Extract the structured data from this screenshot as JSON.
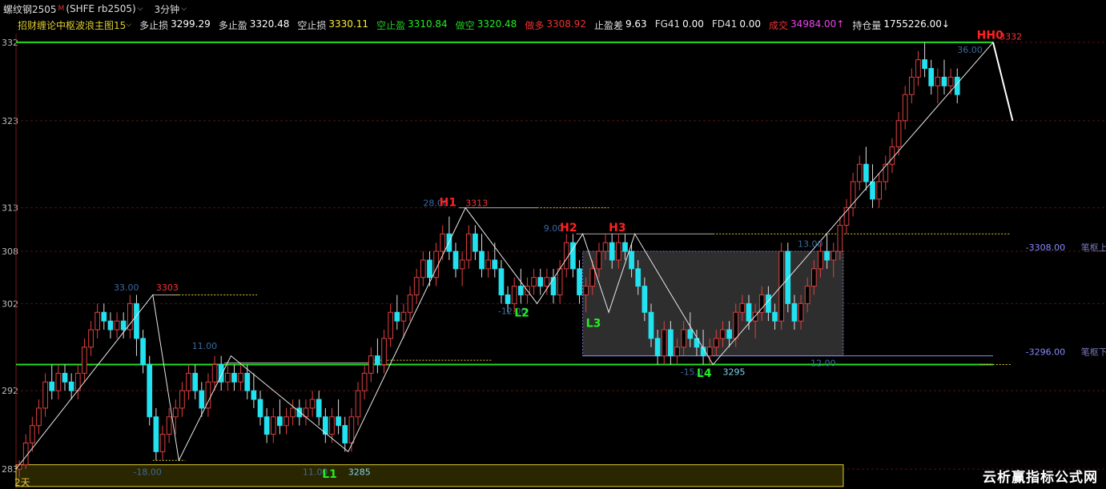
{
  "header": {
    "symbol": "螺纹钢2505",
    "mark": "M",
    "code": "(SHFE rb2505)",
    "period": "3分钟"
  },
  "indicator": {
    "name": "招财缠论中枢波浪主图15",
    "items": [
      {
        "label": "多止损",
        "value": "3299.29",
        "label_color": "#dddddd",
        "value_color": "#ffffff"
      },
      {
        "label": "多止盈",
        "value": "3320.48",
        "label_color": "#dddddd",
        "value_color": "#ffffff"
      },
      {
        "label": "空止损",
        "value": "3330.11",
        "label_color": "#dddddd",
        "value_color": "#ffee33"
      },
      {
        "label": "空止盈",
        "value": "3310.84",
        "label_color": "#22cc22",
        "value_color": "#22ee22"
      },
      {
        "label": "做空",
        "value": "3320.48",
        "label_color": "#22cc22",
        "value_color": "#22ee22"
      },
      {
        "label": "做多",
        "value": "3308.92",
        "label_color": "#ee3333",
        "value_color": "#ee3333"
      },
      {
        "label": "止盈差",
        "value": "9.63",
        "label_color": "#dddddd",
        "value_color": "#ffffff"
      },
      {
        "label": "FG41",
        "value": "0.00",
        "label_color": "#dddddd",
        "value_color": "#ffffff"
      },
      {
        "label": "FD41",
        "value": "0.00",
        "label_color": "#dddddd",
        "value_color": "#ffffff"
      },
      {
        "label": "成交",
        "value": "34984.00↑",
        "label_color": "#ee3333",
        "value_color": "#ee44ee"
      },
      {
        "label": "持仓量",
        "value": "1755226.00↓",
        "label_color": "#dddddd",
        "value_color": "#ffffff"
      }
    ]
  },
  "footer": {
    "days": "2天",
    "watermark": "云析赢指标公式网"
  },
  "chart_data": {
    "type": "candlestick",
    "y_ticks": [
      {
        "value": 3283,
        "label": "283"
      },
      {
        "value": 3292,
        "label": "292"
      },
      {
        "value": 3302,
        "label": "302"
      },
      {
        "value": 3308,
        "label": "308"
      },
      {
        "value": 3313,
        "label": "313"
      },
      {
        "value": 3323,
        "label": "323"
      },
      {
        "value": 3332,
        "label": "332"
      }
    ],
    "ylim": [
      3282,
      3333
    ],
    "xlim": [
      0,
      150
    ],
    "up_color": "#e04040",
    "down_color": "#22e2f0",
    "candles": [
      [
        3283,
        3284,
        3282,
        3283.5
      ],
      [
        3283.5,
        3287,
        3283,
        3286
      ],
      [
        3286,
        3289,
        3285,
        3288
      ],
      [
        3288,
        3291,
        3287,
        3290
      ],
      [
        3290,
        3294,
        3289,
        3293
      ],
      [
        3293,
        3295,
        3291,
        3292
      ],
      [
        3292,
        3295,
        3291,
        3294
      ],
      [
        3294,
        3295,
        3292,
        3293
      ],
      [
        3293,
        3294,
        3291,
        3292
      ],
      [
        3292,
        3295,
        3291,
        3294
      ],
      [
        3294,
        3298,
        3293,
        3297
      ],
      [
        3297,
        3300,
        3296,
        3299
      ],
      [
        3299,
        3302,
        3298,
        3301
      ],
      [
        3301,
        3302,
        3299,
        3300
      ],
      [
        3300,
        3301,
        3298,
        3299
      ],
      [
        3299,
        3301,
        3298,
        3300
      ],
      [
        3300,
        3301,
        3298,
        3299
      ],
      [
        3299,
        3303,
        3298,
        3302
      ],
      [
        3302,
        3303,
        3296,
        3298
      ],
      [
        3298,
        3299,
        3294,
        3295
      ],
      [
        3295,
        3296,
        3288,
        3289
      ],
      [
        3289,
        3290,
        3284,
        3285
      ],
      [
        3285,
        3288,
        3284,
        3287
      ],
      [
        3287,
        3290,
        3286,
        3289
      ],
      [
        3289,
        3291,
        3287,
        3290
      ],
      [
        3290,
        3293,
        3289,
        3292
      ],
      [
        3292,
        3295,
        3291,
        3294
      ],
      [
        3294,
        3295,
        3291,
        3292
      ],
      [
        3292,
        3293,
        3289,
        3290
      ],
      [
        3290,
        3294,
        3289,
        3293
      ],
      [
        3293,
        3296,
        3292,
        3295
      ],
      [
        3295,
        3296,
        3292,
        3293
      ],
      [
        3293,
        3295,
        3292,
        3294
      ],
      [
        3294,
        3295,
        3292,
        3293
      ],
      [
        3293,
        3295,
        3292,
        3294
      ],
      [
        3294,
        3295,
        3291,
        3292
      ],
      [
        3292,
        3294,
        3290,
        3291
      ],
      [
        3291,
        3292,
        3288,
        3289
      ],
      [
        3289,
        3290,
        3286,
        3287
      ],
      [
        3287,
        3290,
        3286,
        3289
      ],
      [
        3289,
        3291,
        3287,
        3288
      ],
      [
        3288,
        3290,
        3287,
        3289
      ],
      [
        3289,
        3291,
        3288,
        3290
      ],
      [
        3290,
        3291,
        3288,
        3289
      ],
      [
        3289,
        3291,
        3288,
        3290
      ],
      [
        3290,
        3292,
        3289,
        3291
      ],
      [
        3291,
        3292,
        3288,
        3289
      ],
      [
        3289,
        3290,
        3286,
        3287
      ],
      [
        3287,
        3290,
        3286,
        3289
      ],
      [
        3289,
        3291,
        3287,
        3288
      ],
      [
        3288,
        3289,
        3285,
        3286
      ],
      [
        3286,
        3290,
        3285,
        3289
      ],
      [
        3289,
        3293,
        3288,
        3292
      ],
      [
        3292,
        3295,
        3291,
        3294
      ],
      [
        3294,
        3297,
        3293,
        3296
      ],
      [
        3296,
        3298,
        3294,
        3295
      ],
      [
        3295,
        3299,
        3294,
        3298
      ],
      [
        3298,
        3302,
        3297,
        3301
      ],
      [
        3301,
        3303,
        3299,
        3300
      ],
      [
        3300,
        3302,
        3298,
        3301
      ],
      [
        3301,
        3304,
        3300,
        3303
      ],
      [
        3303,
        3306,
        3302,
        3305
      ],
      [
        3305,
        3308,
        3304,
        3307
      ],
      [
        3307,
        3308,
        3304,
        3305
      ],
      [
        3305,
        3309,
        3304,
        3308
      ],
      [
        3308,
        3311,
        3307,
        3310
      ],
      [
        3310,
        3312,
        3307,
        3308
      ],
      [
        3308,
        3309,
        3305,
        3306
      ],
      [
        3306,
        3308,
        3304,
        3307
      ],
      [
        3307,
        3311,
        3306,
        3310
      ],
      [
        3310,
        3311,
        3307,
        3308
      ],
      [
        3308,
        3310,
        3305,
        3306
      ],
      [
        3306,
        3308,
        3305,
        3307
      ],
      [
        3307,
        3309,
        3305,
        3306
      ],
      [
        3306,
        3307,
        3302,
        3303
      ],
      [
        3303,
        3304,
        3301,
        3302
      ],
      [
        3302,
        3305,
        3301,
        3304
      ],
      [
        3304,
        3306,
        3302,
        3303
      ],
      [
        3303,
        3305,
        3302,
        3304
      ],
      [
        3304,
        3306,
        3303,
        3305
      ],
      [
        3305,
        3306,
        3303,
        3304
      ],
      [
        3304,
        3306,
        3303,
        3305
      ],
      [
        3305,
        3306,
        3302,
        3303
      ],
      [
        3303,
        3307,
        3302,
        3306
      ],
      [
        3306,
        3310,
        3305,
        3309
      ],
      [
        3309,
        3310,
        3305,
        3306
      ],
      [
        3306,
        3307,
        3302,
        3303
      ],
      [
        3303,
        3305,
        3301,
        3304
      ],
      [
        3304,
        3307,
        3303,
        3306
      ],
      [
        3306,
        3309,
        3305,
        3308
      ],
      [
        3308,
        3310,
        3307,
        3309
      ],
      [
        3309,
        3310,
        3306,
        3307
      ],
      [
        3307,
        3310,
        3306,
        3309
      ],
      [
        3309,
        3310,
        3307,
        3308
      ],
      [
        3308,
        3309,
        3305,
        3306
      ],
      [
        3306,
        3307,
        3303,
        3304
      ],
      [
        3304,
        3305,
        3300,
        3301
      ],
      [
        3301,
        3302,
        3297,
        3298
      ],
      [
        3298,
        3299,
        3295,
        3296
      ],
      [
        3296,
        3300,
        3295,
        3299
      ],
      [
        3299,
        3300,
        3295,
        3296
      ],
      [
        3296,
        3298,
        3295,
        3297
      ],
      [
        3297,
        3300,
        3296,
        3299
      ],
      [
        3299,
        3301,
        3297,
        3298
      ],
      [
        3298,
        3299,
        3296,
        3297
      ],
      [
        3297,
        3299,
        3295,
        3296
      ],
      [
        3296,
        3298,
        3295,
        3297
      ],
      [
        3297,
        3299,
        3296,
        3298
      ],
      [
        3298,
        3300,
        3297,
        3299
      ],
      [
        3299,
        3300,
        3297,
        3298
      ],
      [
        3298,
        3302,
        3297,
        3301
      ],
      [
        3301,
        3303,
        3300,
        3302
      ],
      [
        3302,
        3303,
        3299,
        3300
      ],
      [
        3300,
        3302,
        3298,
        3301
      ],
      [
        3301,
        3304,
        3300,
        3303
      ],
      [
        3303,
        3304,
        3300,
        3301
      ],
      [
        3301,
        3302,
        3299,
        3300
      ],
      [
        3300,
        3309,
        3299,
        3308
      ],
      [
        3308,
        3309,
        3301,
        3302
      ],
      [
        3302,
        3303,
        3299,
        3300
      ],
      [
        3300,
        3303,
        3299,
        3302
      ],
      [
        3302,
        3305,
        3301,
        3304
      ],
      [
        3304,
        3307,
        3303,
        3306
      ],
      [
        3306,
        3309,
        3305,
        3308
      ],
      [
        3308,
        3310,
        3306,
        3307
      ],
      [
        3307,
        3309,
        3305,
        3308
      ],
      [
        3308,
        3312,
        3307,
        3311
      ],
      [
        3311,
        3314,
        3310,
        3313
      ],
      [
        3313,
        3317,
        3312,
        3316
      ],
      [
        3316,
        3319,
        3315,
        3318
      ],
      [
        3318,
        3320,
        3315,
        3316
      ],
      [
        3316,
        3318,
        3313,
        3314
      ],
      [
        3314,
        3317,
        3313,
        3316
      ],
      [
        3316,
        3319,
        3315,
        3318
      ],
      [
        3318,
        3321,
        3317,
        3320
      ],
      [
        3320,
        3324,
        3319,
        3323
      ],
      [
        3323,
        3327,
        3322,
        3326
      ],
      [
        3326,
        3329,
        3325,
        3328
      ],
      [
        3328,
        3331,
        3327,
        3330
      ],
      [
        3330,
        3332,
        3328,
        3329
      ],
      [
        3329,
        3330,
        3326,
        3327
      ],
      [
        3327,
        3329,
        3325,
        3328
      ],
      [
        3328,
        3330,
        3326,
        3327
      ],
      [
        3327,
        3329,
        3326,
        3328
      ],
      [
        3328,
        3329,
        3325,
        3326
      ]
    ],
    "horizontal_lines": [
      {
        "y": 3332,
        "color": "#22dd22",
        "width": 2,
        "x0": 0,
        "x1": 150
      },
      {
        "y": 3295,
        "color": "#22dd22",
        "width": 2,
        "x0": 0,
        "x1": 150
      },
      {
        "y": 3296,
        "color": "#8888ff",
        "width": 1,
        "x0": 87,
        "x1": 150
      },
      {
        "y": 3313,
        "color": "#aaaaaa",
        "width": 1,
        "x0": 68,
        "x1": 80
      },
      {
        "y": 3310,
        "color": "#aaaaaa",
        "width": 1,
        "x0": 86,
        "x1": 107
      },
      {
        "y": 3295.2,
        "color": "#aaaaaa",
        "width": 1,
        "x0": 32,
        "x1": 55
      },
      {
        "y": 3303,
        "color": "#aaaaaa",
        "width": 1,
        "x0": 21,
        "x1": 25
      }
    ],
    "dotted_lines": [
      {
        "y": 3303,
        "x0": 24,
        "x1": 37,
        "color": "#ddcc33"
      },
      {
        "y": 3313,
        "x0": 80,
        "x1": 91,
        "color": "#ddcc33"
      },
      {
        "y": 3310,
        "x0": 107,
        "x1": 154,
        "color": "#ddcc33"
      },
      {
        "y": 3295.5,
        "x0": 55,
        "x1": 73,
        "color": "#ddcc33"
      },
      {
        "y": 3284,
        "x0": 21,
        "x1": 26,
        "color": "#ddcc33"
      },
      {
        "y": 3295,
        "x0": 148,
        "x1": 154,
        "color": "#ddcc33"
      }
    ],
    "zhongshu_box": {
      "x0": 87,
      "x1": 127,
      "y0": 3296,
      "y1": 3308
    },
    "bottom_box": {
      "x0": 0,
      "x1": 127,
      "y0": 3281,
      "y1": 3283.5
    },
    "bi_lines": [
      [
        0,
        3283
      ],
      [
        21,
        3303
      ],
      [
        25,
        3284
      ],
      [
        33,
        3296
      ],
      [
        51,
        3285
      ],
      [
        69,
        3313
      ],
      [
        80,
        3302
      ],
      [
        87,
        3310
      ],
      [
        91,
        3301
      ],
      [
        95,
        3310
      ],
      [
        107,
        3295
      ],
      [
        150,
        3332
      ],
      [
        153,
        3323
      ]
    ],
    "annotations": [
      {
        "text": "33.00",
        "x": 15,
        "y": 3303.5,
        "color": "#3a6aa0",
        "size": 11
      },
      {
        "text": "3303",
        "x": 21.5,
        "y": 3303.5,
        "color": "#ff3333",
        "size": 11
      },
      {
        "text": "11.00",
        "x": 27,
        "y": 3296.8,
        "color": "#3a6aa0",
        "size": 11
      },
      {
        "text": "-18.00",
        "x": 18,
        "y": 3282.3,
        "color": "#3a6aa0",
        "size": 11
      },
      {
        "text": "11.00",
        "x": 44,
        "y": 3282.3,
        "color": "#3a6aa0",
        "size": 11
      },
      {
        "text": "L1",
        "x": 47,
        "y": 3282.0,
        "color": "#22ee22",
        "size": 14
      },
      {
        "text": "3285",
        "x": 51,
        "y": 3282.3,
        "color": "#7fd3f0",
        "size": 11
      },
      {
        "text": "28.00",
        "x": 62.5,
        "y": 3313.2,
        "color": "#3a6aa0",
        "size": 11
      },
      {
        "text": "H1",
        "x": 65,
        "y": 3313.2,
        "color": "#ff2222",
        "size": 14
      },
      {
        "text": "3313",
        "x": 69,
        "y": 3313.2,
        "color": "#ff3333",
        "size": 11
      },
      {
        "text": "9.00",
        "x": 81,
        "y": 3310.3,
        "color": "#3a6aa0",
        "size": 11
      },
      {
        "text": "H2",
        "x": 83.5,
        "y": 3310.3,
        "color": "#ff2222",
        "size": 14
      },
      {
        "text": "H3",
        "x": 91,
        "y": 3310.3,
        "color": "#ff2222",
        "size": 14
      },
      {
        "text": "-12.00",
        "x": 74,
        "y": 3300.8,
        "color": "#3a6aa0",
        "size": 11
      },
      {
        "text": "L2",
        "x": 76.5,
        "y": 3300.5,
        "color": "#22ee22",
        "size": 14
      },
      {
        "text": "L3",
        "x": 87.5,
        "y": 3299.3,
        "color": "#22ee22",
        "size": 14
      },
      {
        "text": "13.00",
        "x": 120,
        "y": 3308.5,
        "color": "#3a6aa0",
        "size": 11
      },
      {
        "text": "-15.0",
        "x": 102,
        "y": 3293.8,
        "color": "#3a6aa0",
        "size": 11
      },
      {
        "text": "L4",
        "x": 104.5,
        "y": 3293.6,
        "color": "#22ee22",
        "size": 14
      },
      {
        "text": "3295",
        "x": 108.5,
        "y": 3293.8,
        "color": "#7fd3f0",
        "size": 11
      },
      {
        "text": "-12.00",
        "x": 121.5,
        "y": 3294.8,
        "color": "#3a6aa0",
        "size": 11
      },
      {
        "text": "36.00",
        "x": 144.5,
        "y": 3330.8,
        "color": "#3a6aa0",
        "size": 11
      },
      {
        "text": "HH0",
        "x": 147.5,
        "y": 3332.4,
        "color": "#ff2222",
        "size": 14
      },
      {
        "text": "3332",
        "x": 151,
        "y": 3332.3,
        "color": "#ff3333",
        "size": 11
      },
      {
        "text": "-3308.00",
        "x": 155,
        "y": 3308.1,
        "color": "#8888ff",
        "size": 11
      },
      {
        "text": "笔枢上沿",
        "x": 163.5,
        "y": 3308.1,
        "color": "#7777bb",
        "size": 11
      },
      {
        "text": "-3296.00",
        "x": 155,
        "y": 3296.1,
        "color": "#8888ff",
        "size": 11
      },
      {
        "text": "笔枢下沿",
        "x": 163.5,
        "y": 3296.1,
        "color": "#7777bb",
        "size": 11
      }
    ]
  }
}
